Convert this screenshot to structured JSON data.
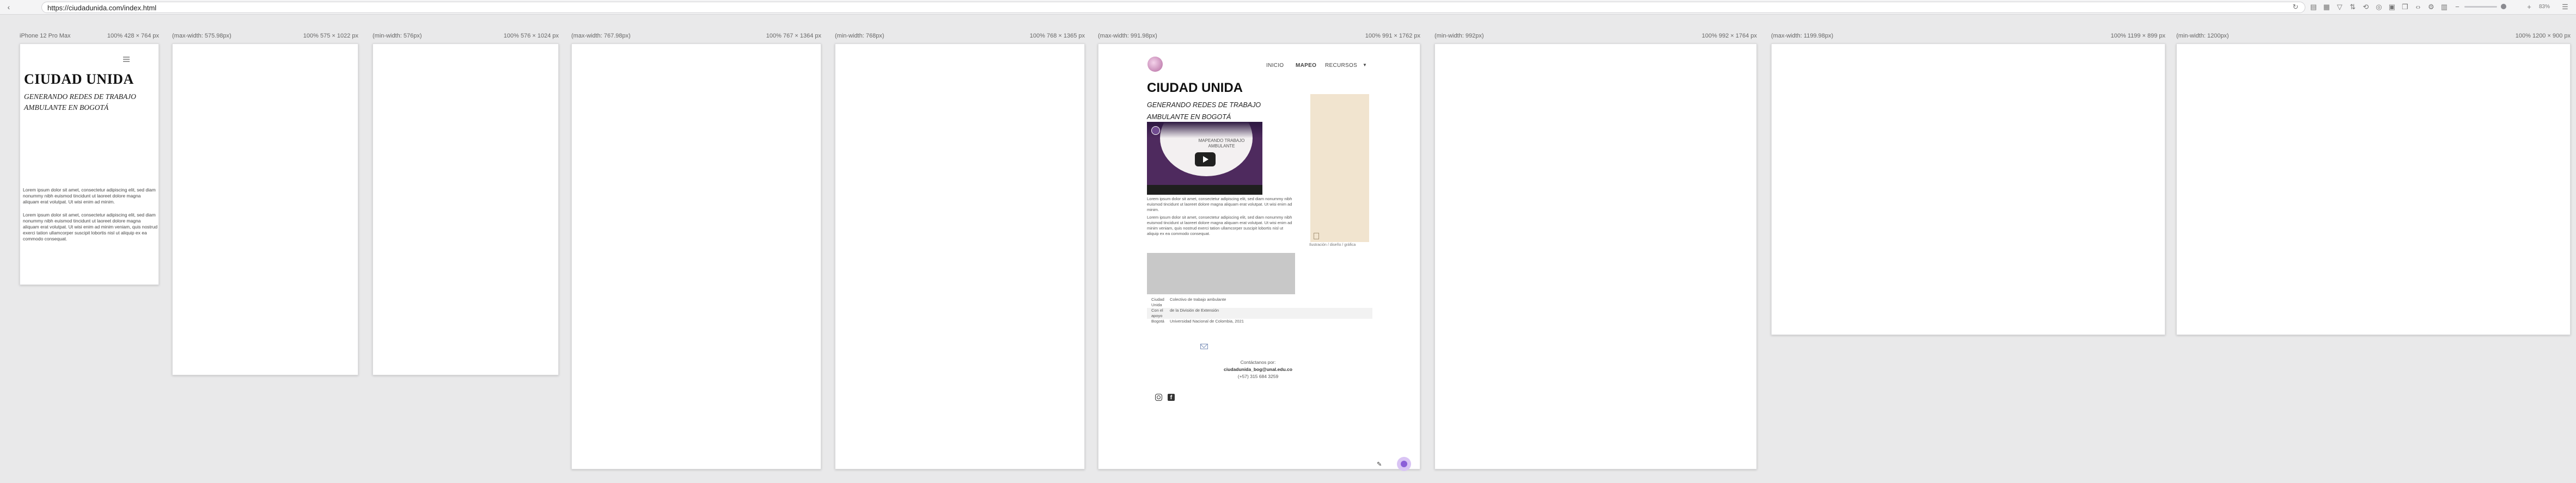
{
  "browser": {
    "url": "https://ciudadunida.com/index.html",
    "zoom": "83%"
  },
  "frames": [
    {
      "label": "iPhone 12 Pro Max",
      "size": "100%   428 × 764 px"
    },
    {
      "label": "(max-width: 575.98px)",
      "size": "100%   575 × 1022 px"
    },
    {
      "label": "(min-width: 576px)",
      "size": "100%   576 × 1024 px"
    },
    {
      "label": "(max-width: 767.98px)",
      "size": "100%   767 × 1364 px"
    },
    {
      "label": "(min-width: 768px)",
      "size": "100%   768 × 1365 px"
    },
    {
      "label": "(max-width: 991.98px)",
      "size": "100%   991 × 1762 px"
    },
    {
      "label": "(min-width: 992px)",
      "size": "100%   992 × 1764 px"
    },
    {
      "label": "(max-width: 1199.98px)",
      "size": "100%   1199 × 899 px"
    },
    {
      "label": "(min-width: 1200px)",
      "size": "100%   1200 × 900 px"
    }
  ],
  "site": {
    "title": "CIUDAD UNIDA",
    "subtitle": "GENERANDO REDES DE TRABAJO AMBULANTE EN BOGOTÁ",
    "nav": [
      "INICIO",
      "MAPEO",
      "RECURSOS"
    ],
    "paragraph_1": "Lorem ipsum dolor sit amet, consectetur adipiscing elit, sed diam nonummy nibh euismod tincidunt ut laoreet dolore magna aliquam erat volutpat. Ut wisi enim ad minim.",
    "paragraph_2": "Lorem ipsum dolor sit amet, consectetur adipiscing elit, sed diam nonummy nibh euismod tincidunt ut laoreet dolore magna aliquam erat volutpat. Ut wisi enim ad minim veniam, quis nostrud exerci tation ullamcorper suscipit lobortis nisl ut aliquip ex ea commodo consequat.",
    "video_caption": "MAPEANDO TRABAJO AMBULANTE",
    "side_caption": "Ilustración / diseño / gráfica",
    "table": [
      {
        "k": "Ciudad Unida",
        "v": "Colectivo de trabajo ambulante"
      },
      {
        "k": "Con el apoyo",
        "v": "de la División de Extensión"
      },
      {
        "k": "Bogotá",
        "v": "Universidad Nacional de Colombia, 2021"
      }
    ],
    "contact_heading": "Contáctanos por:",
    "contact_email": "ciudadunida_bog@unal.edu.co",
    "contact_phone": "(+57) 315 684 3259"
  }
}
